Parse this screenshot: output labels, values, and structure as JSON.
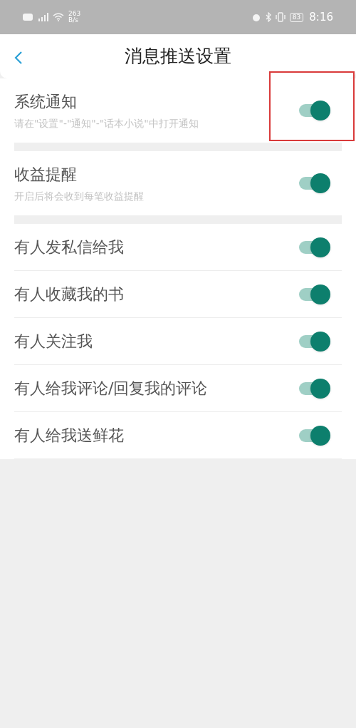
{
  "status_bar": {
    "speed": "263",
    "speed_unit": "B/s",
    "battery": "83",
    "time": "8:16"
  },
  "header": {
    "title": "消息推送设置"
  },
  "sections": [
    {
      "items": [
        {
          "title": "系统通知",
          "subtitle": "请在\"设置\"-\"通知\"-\"话本小说\"中打开通知",
          "on": true,
          "highlighted": true
        }
      ]
    },
    {
      "items": [
        {
          "title": "收益提醒",
          "subtitle": "开启后将会收到每笔收益提醒",
          "on": true,
          "highlighted": false
        }
      ]
    },
    {
      "items": [
        {
          "title": "有人发私信给我",
          "on": true,
          "highlighted": false
        },
        {
          "title": "有人收藏我的书",
          "on": true,
          "highlighted": false
        },
        {
          "title": "有人关注我",
          "on": true,
          "highlighted": false
        },
        {
          "title": "有人给我评论/回复我的评论",
          "on": true,
          "highlighted": false
        },
        {
          "title": "有人给我送鲜花",
          "on": true,
          "highlighted": false
        }
      ]
    }
  ]
}
